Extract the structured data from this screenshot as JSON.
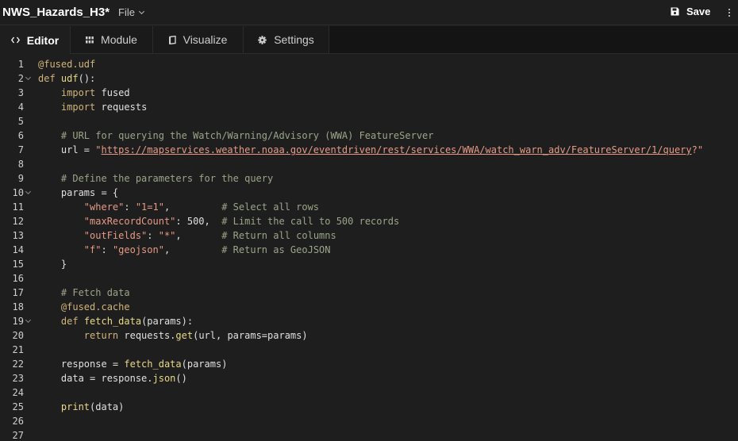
{
  "app": {
    "title": "NWS_Hazards_H3*",
    "file_menu": "File",
    "save_label": "Save"
  },
  "tabs": [
    {
      "label": "Editor",
      "icon": "code-icon",
      "active": true
    },
    {
      "label": "Module",
      "icon": "grid-icon",
      "active": false
    },
    {
      "label": "Visualize",
      "icon": "layers-icon",
      "active": false
    },
    {
      "label": "Settings",
      "icon": "gear-icon",
      "active": false
    }
  ],
  "code": {
    "lines": [
      {
        "n": "1",
        "text": "@fused.udf",
        "fold": false
      },
      {
        "n": "2",
        "text": "def udf():",
        "fold": true
      },
      {
        "n": "3",
        "text": "    import fused",
        "fold": false
      },
      {
        "n": "4",
        "text": "    import requests",
        "fold": false
      },
      {
        "n": "5",
        "text": "",
        "fold": false
      },
      {
        "n": "6",
        "text": "    # URL for querying the Watch/Warning/Advisory (WWA) FeatureServer",
        "fold": false
      },
      {
        "n": "7",
        "text": "    url = \"https://mapservices.weather.noaa.gov/eventdriven/rest/services/WWA/watch_warn_adv/FeatureServer/1/query?\"",
        "fold": false
      },
      {
        "n": "8",
        "text": "",
        "fold": false
      },
      {
        "n": "9",
        "text": "    # Define the parameters for the query",
        "fold": false
      },
      {
        "n": "10",
        "text": "    params = {",
        "fold": true
      },
      {
        "n": "11",
        "text": "        \"where\": \"1=1\",         # Select all rows",
        "fold": false
      },
      {
        "n": "12",
        "text": "        \"maxRecordCount\": 500,  # Limit the call to 500 records",
        "fold": false
      },
      {
        "n": "13",
        "text": "        \"outFields\": \"*\",       # Return all columns",
        "fold": false
      },
      {
        "n": "14",
        "text": "        \"f\": \"geojson\",         # Return as GeoJSON",
        "fold": false
      },
      {
        "n": "15",
        "text": "    }",
        "fold": false
      },
      {
        "n": "16",
        "text": "",
        "fold": false
      },
      {
        "n": "17",
        "text": "    # Fetch data",
        "fold": false
      },
      {
        "n": "18",
        "text": "    @fused.cache",
        "fold": false
      },
      {
        "n": "19",
        "text": "    def fetch_data(params):",
        "fold": true
      },
      {
        "n": "20",
        "text": "        return requests.get(url, params=params)",
        "fold": false
      },
      {
        "n": "21",
        "text": "",
        "fold": false
      },
      {
        "n": "22",
        "text": "    response = fetch_data(params)",
        "fold": false
      },
      {
        "n": "23",
        "text": "    data = response.json()",
        "fold": false
      },
      {
        "n": "24",
        "text": "",
        "fold": false
      },
      {
        "n": "25",
        "text": "    print(data)",
        "fold": false
      },
      {
        "n": "26",
        "text": "",
        "fold": false
      },
      {
        "n": "27",
        "text": "",
        "fold": false
      }
    ]
  },
  "colors": {
    "background": "#1e1e1e",
    "keyword": "#d2b47a",
    "string": "#e69a86",
    "comment": "#9aa58a",
    "function": "#e8d98a"
  }
}
